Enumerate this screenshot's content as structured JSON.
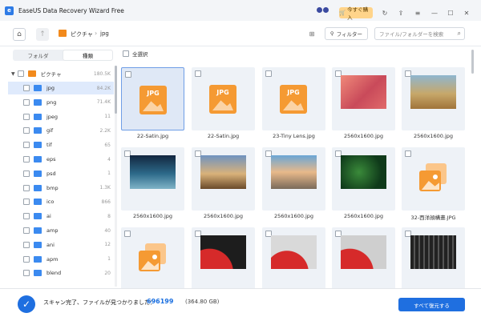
{
  "app": {
    "title": "EaseUS Data Recovery Wizard Free",
    "logo_letter": "e"
  },
  "titlebar": {
    "buy_label": "今すぐ購入",
    "icons": [
      "ninja-mascot-icon",
      "cart-icon",
      "feedback-icon",
      "upgrade-icon",
      "menu-icon",
      "minimize-icon",
      "maximize-icon",
      "close-icon"
    ]
  },
  "nav": {
    "home_icon": "⌂",
    "up_icon": "↑",
    "breadcrumb": [
      "ピクチャ",
      "jpg"
    ],
    "breadcrumb_sep": "›",
    "view_icon": "⊞",
    "filter_label": "フィルター",
    "search_placeholder": "ファイル/フォルダーを検索"
  },
  "sidebar": {
    "tabs": [
      "フォルダ",
      "種類"
    ],
    "active_tab": 1,
    "root": {
      "name": "ピクチャ",
      "count": "180.5K"
    },
    "items": [
      {
        "name": "jpg",
        "count": "84.2K"
      },
      {
        "name": "png",
        "count": "71.4K"
      },
      {
        "name": "jpeg",
        "count": "11"
      },
      {
        "name": "gif",
        "count": "2.2K"
      },
      {
        "name": "tif",
        "count": "65"
      },
      {
        "name": "eps",
        "count": "4"
      },
      {
        "name": "psd",
        "count": "1"
      },
      {
        "name": "bmp",
        "count": "1.3K"
      },
      {
        "name": "ico",
        "count": "866"
      },
      {
        "name": "ai",
        "count": "8"
      },
      {
        "name": "amp",
        "count": "40"
      },
      {
        "name": "ani",
        "count": "12"
      },
      {
        "name": "apm",
        "count": "1"
      },
      {
        "name": "blend",
        "count": "20"
      }
    ]
  },
  "content": {
    "select_all_label": "全選択",
    "tiles": [
      {
        "caption": "22-Satin.jpg",
        "kind": "jpg-icon",
        "selected": true
      },
      {
        "caption": "22-Satin.jpg",
        "kind": "jpg-icon",
        "selected": false
      },
      {
        "caption": "23-Tiny Lens.jpg",
        "kind": "jpg-icon",
        "selected": false
      },
      {
        "caption": "2560x1600.jpg",
        "kind": "photo",
        "selected": false
      },
      {
        "caption": "2560x1600.jpg",
        "kind": "photo",
        "selected": false
      },
      {
        "caption": "2560x1600.jpg",
        "kind": "photo",
        "selected": false
      },
      {
        "caption": "2560x1600.jpg",
        "kind": "photo",
        "selected": false
      },
      {
        "caption": "2560x1600.jpg",
        "kind": "photo",
        "selected": false
      },
      {
        "caption": "2560x1600.jpg",
        "kind": "photo",
        "selected": false
      },
      {
        "caption": "32-西洋顔構畫.JPG",
        "kind": "image-icon",
        "selected": false
      },
      {
        "caption": "",
        "kind": "image-icon",
        "selected": false
      },
      {
        "caption": "",
        "kind": "photo",
        "selected": false
      },
      {
        "caption": "",
        "kind": "photo",
        "selected": false
      },
      {
        "caption": "",
        "kind": "photo",
        "selected": false
      },
      {
        "caption": "",
        "kind": "photo",
        "selected": false
      }
    ],
    "jpg_label": "JPG"
  },
  "footer": {
    "status_text": "スキャン完了、ファイルが見つかりました：",
    "count": "696199",
    "size": "(364.80 GB)",
    "recover_label": "すべて復元する"
  },
  "colors": {
    "accent": "#1f6fe0",
    "folder_orange": "#f28a1c",
    "folder_blue": "#3b8af0",
    "buy_bg": "#ffd48a"
  }
}
